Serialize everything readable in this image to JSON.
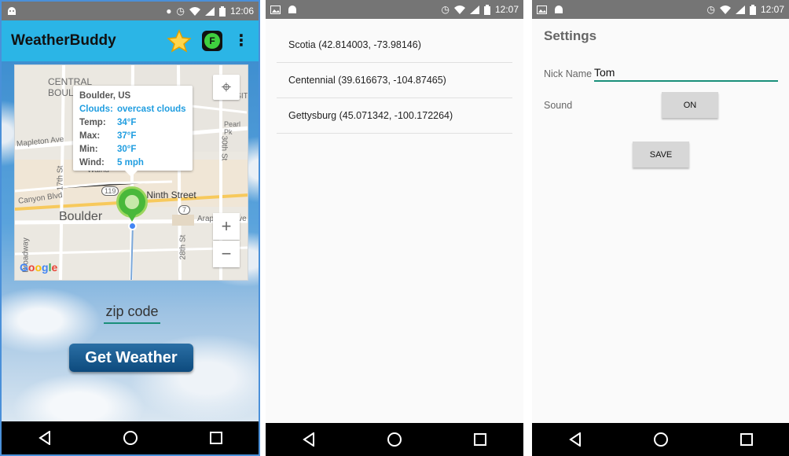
{
  "panel1": {
    "status": {
      "time": "12:06",
      "left_icon": "android-icon",
      "right_icons": [
        "location-icon",
        "alarm-icon",
        "wifi-icon",
        "signal-icon",
        "battery-icon"
      ]
    },
    "appbar": {
      "title": "WeatherBuddy",
      "favorites_icon": "star-icon",
      "app_icon_letter": "F",
      "overflow_icon": "more-vert-icon"
    },
    "map": {
      "labels": {
        "central_boulder_1": "CENTRAL",
        "central_boulder_2": "BOULI",
        "transit": "TRANSIT",
        "pearl": "Pearl Pk",
        "mapleton": "Mapleton Ave",
        "seventeenth": "17th St",
        "thirtieth": "30th St",
        "canyon": "Canyon Blvd",
        "walnut": "Walnu",
        "ninth": "y Ninth Street",
        "boulder": "Boulder",
        "arapahoe": "Arapahoe Ave",
        "twentyeighth": "28th St",
        "broadway": "Broadway",
        "route119": "119",
        "route7": "7",
        "google": "Google"
      },
      "info": {
        "place": "Boulder, US",
        "rows": [
          {
            "k": "Clouds:",
            "v": "overcast clouds"
          },
          {
            "k": "Temp:",
            "v": "34°F"
          },
          {
            "k": "Max:",
            "v": "37°F"
          },
          {
            "k": "Min:",
            "v": "30°F"
          },
          {
            "k": "Wind:",
            "v": "5 mph"
          }
        ]
      },
      "controls": {
        "locate": "⌖",
        "zoom_in": "+",
        "zoom_out": "−"
      }
    },
    "zip_placeholder": "zip code",
    "get_weather": "Get Weather",
    "colors": {
      "appbar": "#2bb5e6",
      "accent": "#1f9de0",
      "button": "#0d4a7d",
      "pin": "#49b83a"
    }
  },
  "panel2": {
    "status": {
      "time": "12:07"
    },
    "locations": [
      "Scotia (42.814003, -73.98146)",
      "Centennial (39.616673, -104.87465)",
      "Gettysburg (45.071342, -100.172264)"
    ]
  },
  "panel3": {
    "status": {
      "time": "12:07"
    },
    "title": "Settings",
    "nick_label": "Nick Name",
    "nick_value": "Tom",
    "sound_label": "Sound",
    "sound_toggle": "ON",
    "save": "SAVE"
  },
  "nav": {
    "back": "◁",
    "home": "○",
    "recents": "□"
  }
}
